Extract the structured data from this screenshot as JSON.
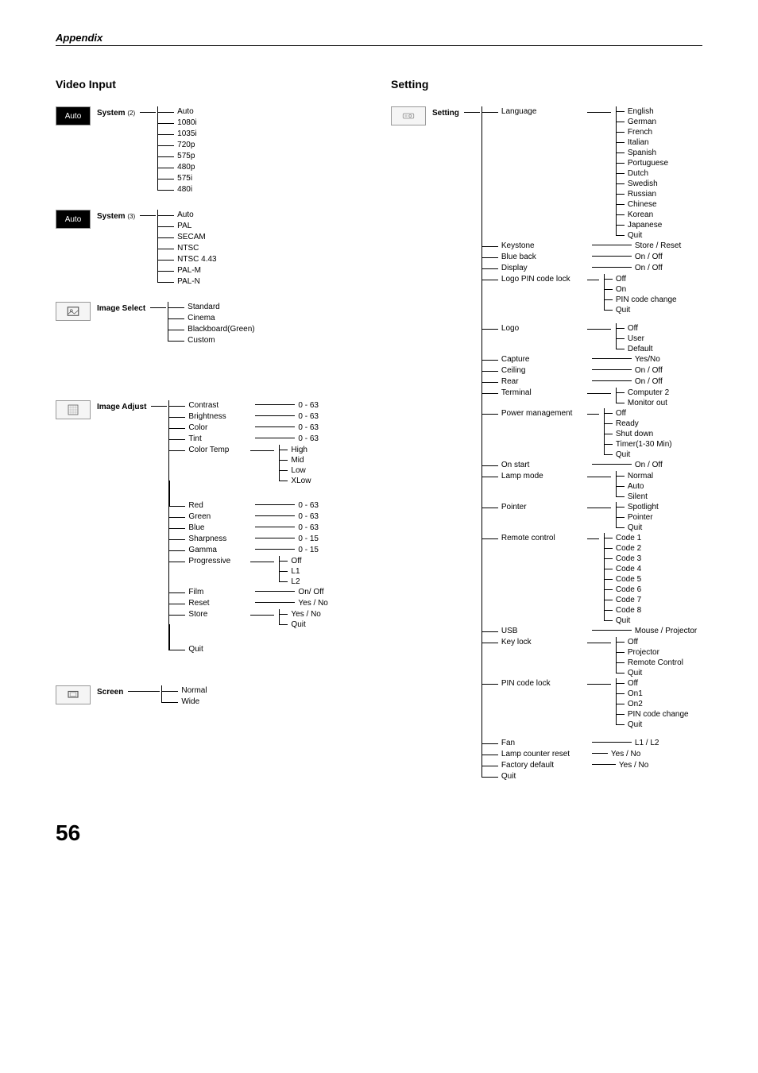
{
  "header": {
    "section": "Appendix"
  },
  "page_number": "56",
  "video_input": {
    "title": "Video Input",
    "system2": {
      "label": "System",
      "sub": "(2)",
      "icon_text": "Auto",
      "items": [
        "Auto",
        "1080i",
        "1035i",
        "720p",
        "575p",
        "480p",
        "575i",
        "480i"
      ]
    },
    "system3": {
      "label": "System",
      "sub": "(3)",
      "icon_text": "Auto",
      "items": [
        "Auto",
        "PAL",
        "SECAM",
        "NTSC",
        "NTSC 4.43",
        "PAL-M",
        "PAL-N"
      ]
    },
    "image_select": {
      "label": "Image Select",
      "items": [
        "Standard",
        "Cinema",
        "Blackboard(Green)",
        "Custom"
      ]
    },
    "image_adjust": {
      "label": "Image Adjust",
      "rows": [
        {
          "name": "Contrast",
          "value": "0 - 63"
        },
        {
          "name": "Brightness",
          "value": "0 - 63"
        },
        {
          "name": "Color",
          "value": "0 - 63"
        },
        {
          "name": "Tint",
          "value": "0 - 63"
        }
      ],
      "color_temp": {
        "name": "Color Temp",
        "subs": [
          "High",
          "Mid",
          "Low",
          "XLow"
        ]
      },
      "rows2": [
        {
          "name": "Red",
          "value": "0 - 63"
        },
        {
          "name": "Green",
          "value": "0 - 63"
        },
        {
          "name": "Blue",
          "value": "0 - 63"
        },
        {
          "name": "Sharpness",
          "value": "0 - 15"
        },
        {
          "name": "Gamma",
          "value": "0 - 15"
        }
      ],
      "progressive": {
        "name": "Progressive",
        "subs": [
          "Off",
          "L1",
          "L2"
        ]
      },
      "rows3": [
        {
          "name": "Film",
          "value": "On/ Off"
        },
        {
          "name": "Reset",
          "value": "Yes / No"
        }
      ],
      "store": {
        "name": "Store",
        "subs": [
          "Yes / No",
          "Quit"
        ]
      },
      "quit": "Quit"
    },
    "screen": {
      "label": "Screen",
      "items": [
        "Normal",
        "Wide"
      ]
    }
  },
  "setting": {
    "title": "Setting",
    "label": "Setting",
    "language": {
      "name": "Language",
      "subs": [
        "English",
        "German",
        "French",
        "Italian",
        "Spanish",
        "Portuguese",
        "Dutch",
        "Swedish",
        "Russian",
        "Chinese",
        "Korean",
        "Japanese",
        "Quit"
      ]
    },
    "simple_rows": [
      {
        "name": "Keystone",
        "value": "Store / Reset"
      },
      {
        "name": "Blue back",
        "value": "On / Off"
      },
      {
        "name": "Display",
        "value": "On / Off"
      }
    ],
    "logo_pin": {
      "name": "Logo PIN code lock",
      "subs": [
        "Off",
        "On",
        "PIN code change",
        "Quit"
      ]
    },
    "logo": {
      "name": "Logo",
      "subs": [
        "Off",
        "User",
        "Default"
      ]
    },
    "simple_rows2": [
      {
        "name": "Capture",
        "value": "Yes/No"
      },
      {
        "name": "Ceiling",
        "value": "On / Off"
      },
      {
        "name": "Rear",
        "value": "On / Off"
      }
    ],
    "terminal": {
      "name": "Terminal",
      "subs": [
        "Computer 2",
        "Monitor out"
      ]
    },
    "power_mgmt": {
      "name": "Power management",
      "subs": [
        "Off",
        "Ready",
        "Shut down",
        "Timer(1-30 Min)",
        "Quit"
      ]
    },
    "on_start": {
      "name": "On start",
      "value": "On / Off"
    },
    "lamp_mode": {
      "name": "Lamp mode",
      "subs": [
        "Normal",
        "Auto",
        "Silent"
      ]
    },
    "pointer": {
      "name": "Pointer",
      "subs": [
        "Spotlight",
        "Pointer",
        "Quit"
      ]
    },
    "remote": {
      "name": "Remote control",
      "subs": [
        "Code 1",
        "Code 2",
        "Code 3",
        "Code 4",
        "Code 5",
        "Code 6",
        "Code 7",
        "Code 8",
        "Quit"
      ]
    },
    "usb": {
      "name": "USB",
      "value": "Mouse / Projector"
    },
    "key_lock": {
      "name": "Key lock",
      "subs": [
        "Off",
        "Projector",
        "Remote Control",
        "Quit"
      ]
    },
    "pin_code": {
      "name": "PIN code lock",
      "subs": [
        "Off",
        "On1",
        "On2",
        "PIN code change",
        "Quit"
      ]
    },
    "fan": {
      "name": "Fan",
      "value": "L1 / L2"
    },
    "lamp_reset": {
      "name": "Lamp counter reset",
      "value": "Yes / No"
    },
    "factory": {
      "name": "Factory default",
      "value": "Yes / No"
    },
    "quit": "Quit"
  },
  "chart_data": {
    "type": "tree",
    "note": "Hierarchical projector on-screen-menu map. Left column = Video Input menus, right column = Setting menu. Each top-level menu expands to submenus, some submenus expand to value ranges or option lists.",
    "video_input": {
      "System (2)": [
        "Auto",
        "1080i",
        "1035i",
        "720p",
        "575p",
        "480p",
        "575i",
        "480i"
      ],
      "System (3)": [
        "Auto",
        "PAL",
        "SECAM",
        "NTSC",
        "NTSC 4.43",
        "PAL-M",
        "PAL-N"
      ],
      "Image Select": [
        "Standard",
        "Cinema",
        "Blackboard(Green)",
        "Custom"
      ],
      "Image Adjust": {
        "Contrast": "0 - 63",
        "Brightness": "0 - 63",
        "Color": "0 - 63",
        "Tint": "0 - 63",
        "Color Temp": [
          "High",
          "Mid",
          "Low",
          "XLow"
        ],
        "Red": "0 - 63",
        "Green": "0 - 63",
        "Blue": "0 - 63",
        "Sharpness": "0 - 15",
        "Gamma": "0 - 15",
        "Progressive": [
          "Off",
          "L1",
          "L2"
        ],
        "Film": "On/ Off",
        "Reset": "Yes / No",
        "Store": [
          "Yes / No",
          "Quit"
        ],
        "Quit": null
      },
      "Screen": [
        "Normal",
        "Wide"
      ]
    },
    "setting": {
      "Language": [
        "English",
        "German",
        "French",
        "Italian",
        "Spanish",
        "Portuguese",
        "Dutch",
        "Swedish",
        "Russian",
        "Chinese",
        "Korean",
        "Japanese",
        "Quit"
      ],
      "Keystone": "Store / Reset",
      "Blue back": "On / Off",
      "Display": "On / Off",
      "Logo PIN code lock": [
        "Off",
        "On",
        "PIN code change",
        "Quit"
      ],
      "Logo": [
        "Off",
        "User",
        "Default"
      ],
      "Capture": "Yes/No",
      "Ceiling": "On / Off",
      "Rear": "On / Off",
      "Terminal": [
        "Computer 2",
        "Monitor out"
      ],
      "Power management": [
        "Off",
        "Ready",
        "Shut down",
        "Timer(1-30 Min)",
        "Quit"
      ],
      "On start": "On / Off",
      "Lamp mode": [
        "Normal",
        "Auto",
        "Silent"
      ],
      "Pointer": [
        "Spotlight",
        "Pointer",
        "Quit"
      ],
      "Remote control": [
        "Code 1",
        "Code 2",
        "Code 3",
        "Code 4",
        "Code 5",
        "Code 6",
        "Code 7",
        "Code 8",
        "Quit"
      ],
      "USB": "Mouse / Projector",
      "Key lock": [
        "Off",
        "Projector",
        "Remote Control",
        "Quit"
      ],
      "PIN code lock": [
        "Off",
        "On1",
        "On2",
        "PIN code change",
        "Quit"
      ],
      "Fan": "L1 / L2",
      "Lamp counter reset": "Yes / No",
      "Factory default": "Yes / No",
      "Quit": null
    }
  }
}
